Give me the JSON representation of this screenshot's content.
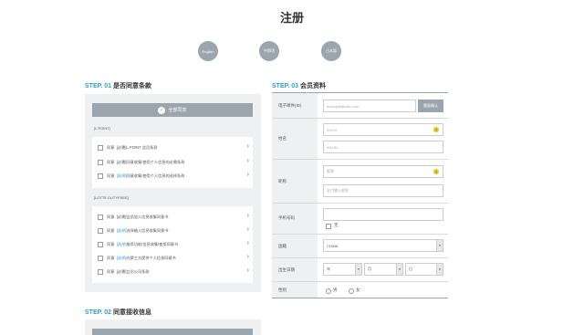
{
  "page": {
    "title": "注册"
  },
  "languages": [
    "English",
    "中国语",
    "日本語"
  ],
  "step1": {
    "no": "STEP. 01",
    "title": "是否同意条款",
    "agree_all": "全部同意",
    "groups": [
      {
        "name": "[L.POINT]",
        "items": [
          {
            "prefix": "同意",
            "tag": "[必需]",
            "text": "L.POINT 会员条款",
            "tag_type": "normal"
          },
          {
            "prefix": "同意",
            "tag": "[必需]",
            "text": "同意收集/使用个人信息的必需条款",
            "tag_type": "normal"
          },
          {
            "prefix": "同意",
            "tag": "[选择]",
            "text": "同意收集/使用个人信息的选择条款",
            "tag_type": "select"
          }
        ]
      },
      {
        "name": "[LOTTE DUTYFREE]",
        "items": [
          {
            "prefix": "同意",
            "tag": "[必需]",
            "text": "会员加入信息收集同意书",
            "tag_type": "normal"
          },
          {
            "prefix": "同意",
            "tag": "[选择]",
            "text": "选择输入信息收集同意书",
            "tag_type": "select"
          },
          {
            "prefix": "同意",
            "tag": "[选择]",
            "text": "推荐功能/信息收集/使用同意书",
            "tag_type": "select"
          },
          {
            "prefix": "同意",
            "tag": "[选择]",
            "text": "向第三方提供个人信息同意书",
            "tag_type": "select"
          },
          {
            "prefix": "同意",
            "tag": "[必需]",
            "text": "会员公司条款",
            "tag_type": "normal"
          }
        ]
      }
    ]
  },
  "step2": {
    "no": "STEP. 02",
    "title": "同意接收信息"
  },
  "step3": {
    "no": "STEP. 03",
    "title": "会员资料",
    "email": {
      "label": "电子邮件(ID)",
      "placeholder": "example@lotte.com",
      "button": "重复确认"
    },
    "name": {
      "label": "姓名",
      "last_placeholder": "ZHOU",
      "first_placeholder": "WLUN"
    },
    "nickname": {
      "label": "昵称",
      "placeholder1": "昵称",
      "placeholder2": "支付输入昵称"
    },
    "mobile": {
      "label": "手机号码",
      "none_label": "无"
    },
    "nation": {
      "label": "国籍",
      "value": "CHINA"
    },
    "birth": {
      "label": "出生日期",
      "year": "年",
      "month": "月",
      "day": "日"
    },
    "gender": {
      "label": "性别",
      "male": "男",
      "female": "女"
    }
  },
  "colors": {
    "accent": "#2b9ed6",
    "panel": "#eef0f2",
    "button": "#9aa5ad",
    "hint": "#f5c518"
  },
  "icons": [
    "check-circle-icon",
    "chevron-right-icon",
    "question-icon",
    "dropdown-arrow-icon"
  ]
}
